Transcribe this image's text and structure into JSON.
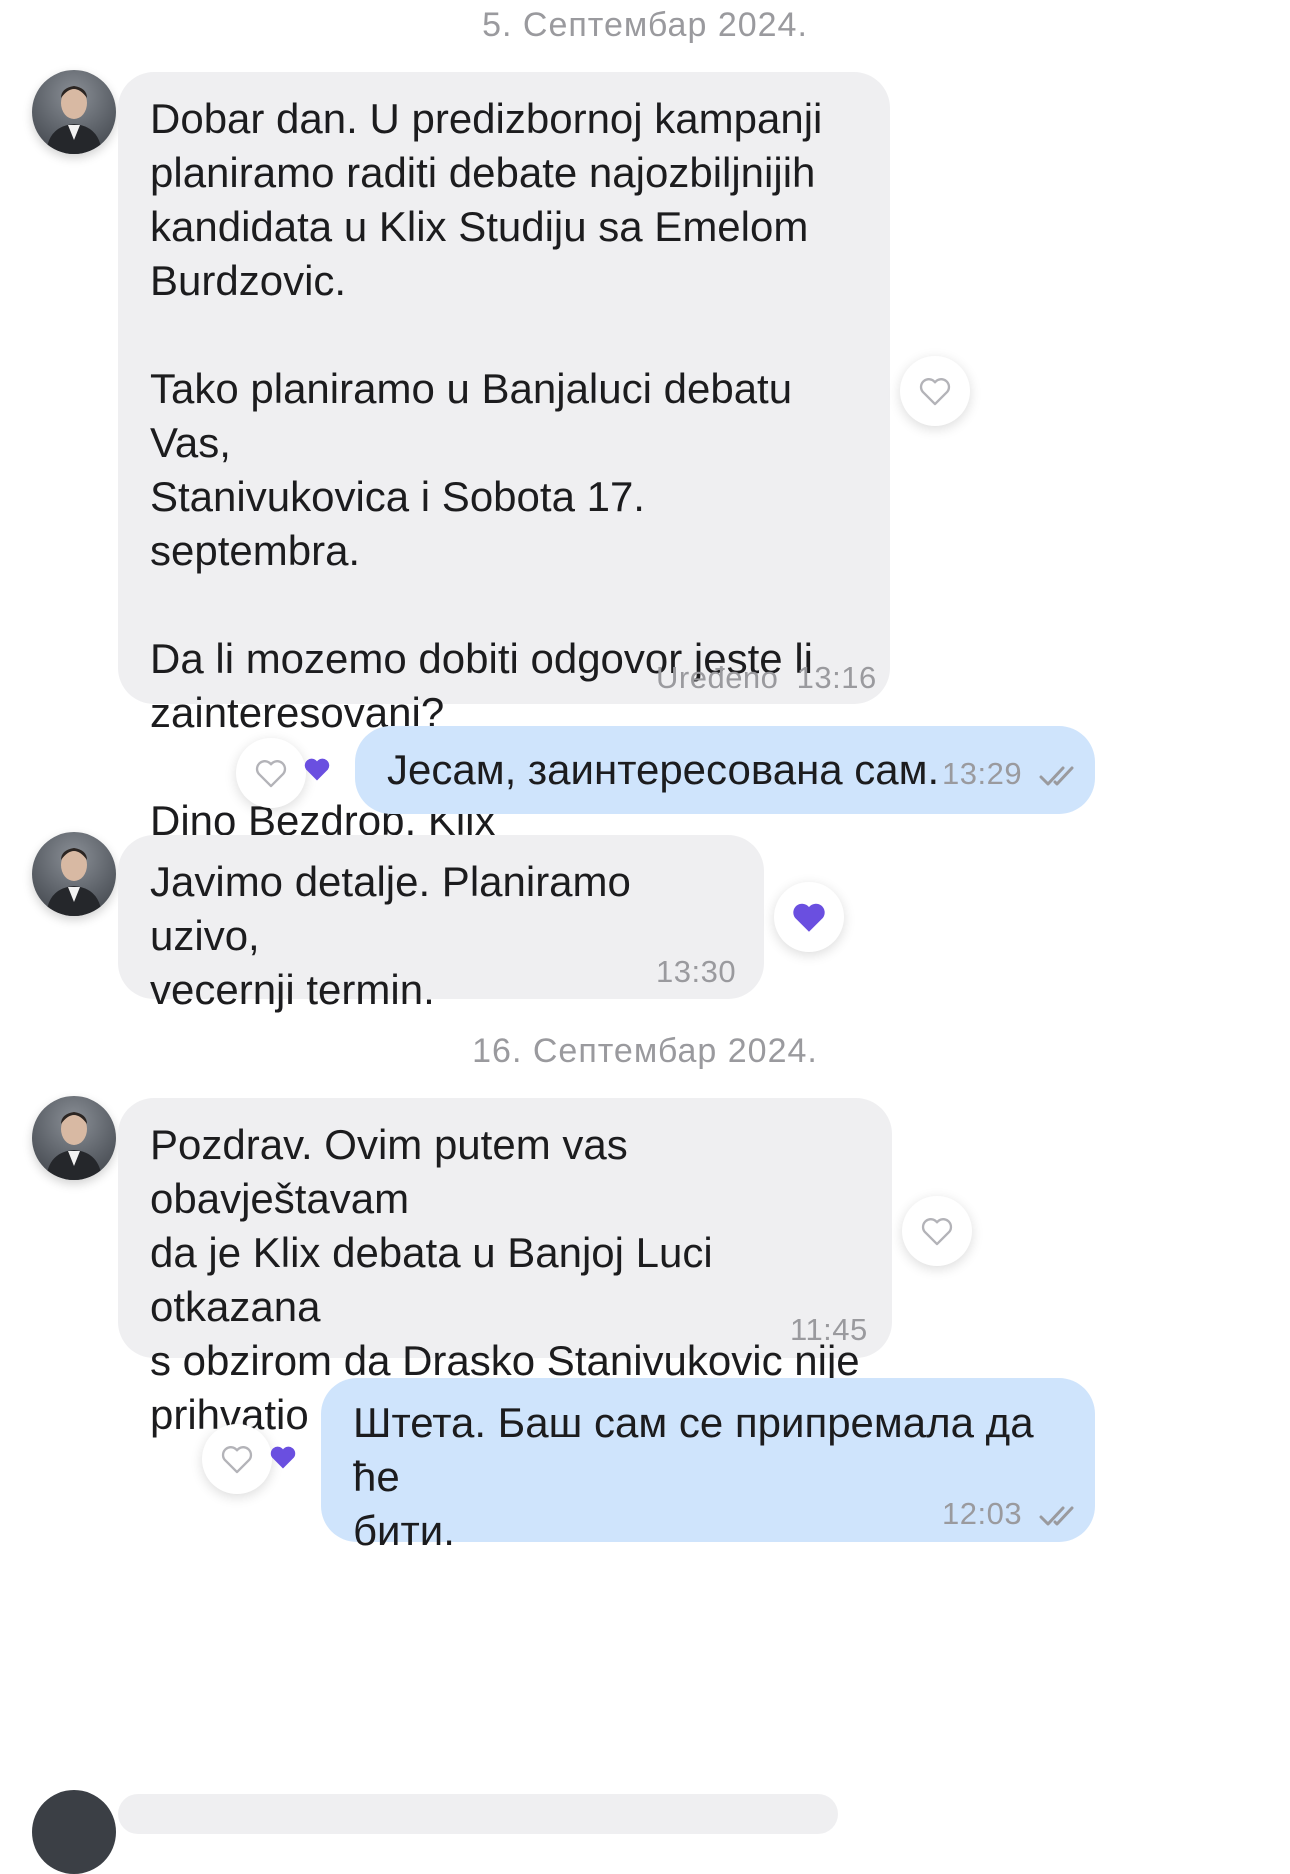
{
  "dates": [
    "5. Септембар 2024.",
    "16. Септембар 2024."
  ],
  "messages": [
    {
      "side": "in",
      "text": "Dobar dan. U predizbornoj kampanji\nplaniramo raditi debate najozbiljnijih\nkandidata u Klix Studiju sa Emelom\nBurdzovic.\n\nTako planiramo u Banjaluci debatu Vas,\nStanivukovica i Sobota 17. septembra.\n\nDa li mozemo dobiti odgovor jeste li\nzainteresovani?\n\nDino Bezdrob, Klix",
      "edited": "Uređeno",
      "time": "13:16"
    },
    {
      "side": "out",
      "text": "Јесам, заинтересована сам.",
      "time": "13:29"
    },
    {
      "side": "in",
      "text": "Javimo detalje. Planiramo uzivo,\nvecernji termin.",
      "time": "13:30"
    },
    {
      "side": "in",
      "text": "Pozdrav. Ovim putem vas obavještavam\nda je Klix debata u Banjoj Luci otkazana\ns obzirom da Drasko Stanivukovic nije\nprihvatio poziv da ucestvuje.",
      "time": "11:45"
    },
    {
      "side": "out",
      "text": "Штета. Баш сам се припремала да ће\nбити.",
      "time": "12:03"
    }
  ],
  "colors": {
    "incoming_bubble": "#efeff1",
    "outgoing_bubble": "#cfe4fc",
    "reaction_purple": "#6a4fe0",
    "meta_gray": "#9a9a9e"
  },
  "icons": {
    "like": "heart-outline-icon",
    "liked": "heart-filled-icon",
    "read": "double-check-icon"
  }
}
